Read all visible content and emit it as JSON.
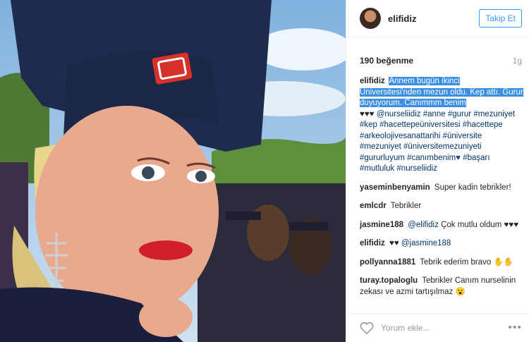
{
  "post": {
    "username": "elifidiz",
    "follow_label": "Takip Et",
    "likes": "190 beğenme",
    "age": "1g",
    "add_comment_placeholder": "Yorum ekle...",
    "more_label": "•••"
  },
  "caption": {
    "user": "elifidiz",
    "highlighted": "Annem bugün ikinci Üniversitesi'nden mezun oldu. Kep attı. Gurur duyuyorum. Canımmm benim",
    "hearts": "♥♥♥",
    "tags_1": "@nurseliidiz #anne #gurur #mezuniyet #kep #hacettepeüniversitesi #hacettepe #arkeolojivesanattarihi #üniversite #mezuniyet #üniversitemezuniyeti #gururluyum #canımbenim",
    "heart_blue": "♥",
    "tags_2": "#başarı #mutluluk #nurseliidiz"
  },
  "comments": [
    {
      "user": "yaseminbenyamin",
      "text": "Super kadin tebrikler!"
    },
    {
      "user": "emlcdr",
      "text": "Tebrikler"
    },
    {
      "user": "jasmine188",
      "mention": "@elifidiz",
      "text": "Çok mutlu oldum ♥♥♥"
    },
    {
      "user": "elifidiz",
      "text": "♥♥",
      "mention": "@jasmine188"
    },
    {
      "user": "pollyanna1881",
      "text": "Tebrik ederim bravo ✋✋"
    },
    {
      "user": "turay.topaloglu",
      "text": "Tebrikler Canım nurselinin zekası ve azmi tartışılmaz 😮"
    }
  ]
}
